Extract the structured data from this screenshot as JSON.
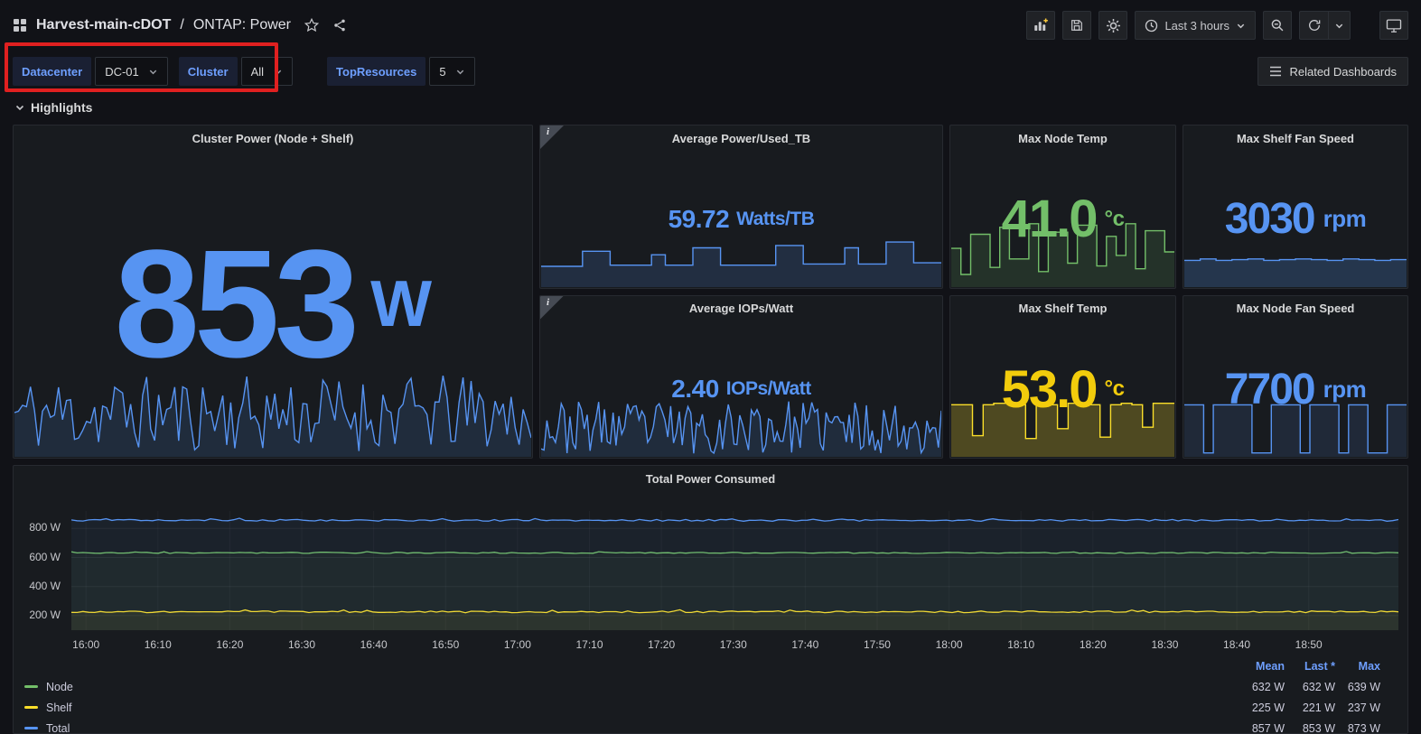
{
  "colors": {
    "blue": "#5794F2",
    "green": "#73BF69",
    "yellow": "#FADE2A",
    "yellow_text": "#F2CC0C",
    "annotation_red": "#E02020"
  },
  "topbar": {
    "breadcrumb": {
      "dashboard": "Harvest-main-cDOT",
      "separator": "/",
      "page": "ONTAP: Power"
    },
    "time_picker": {
      "label": "Last 3 hours"
    }
  },
  "variable_bar": {
    "variables": [
      {
        "label": "Datacenter",
        "value": "DC-01"
      },
      {
        "label": "Cluster",
        "value": "All"
      },
      {
        "label": "TopResources",
        "value": "5"
      }
    ],
    "related_dashboards_label": "Related Dashboards"
  },
  "rows": {
    "highlights": "Highlights"
  },
  "stats": {
    "cluster_power": {
      "title": "Cluster Power (Node + Shelf)",
      "value": "853",
      "unit": "W",
      "color": "#5794F2"
    },
    "avg_power_tb": {
      "title": "Average Power/Used_TB",
      "value": "59.72",
      "unit": "Watts/TB",
      "color": "#5794F2"
    },
    "avg_iops_watt": {
      "title": "Average IOPs/Watt",
      "value": "2.40",
      "unit": "IOPs/Watt",
      "color": "#5794F2"
    },
    "max_node_temp": {
      "title": "Max Node Temp",
      "value": "41.0",
      "unit": "°c",
      "color": "#73BF69"
    },
    "max_shelf_temp": {
      "title": "Max Shelf Temp",
      "value": "53.0",
      "unit": "°c",
      "color": "#F2CC0C"
    },
    "max_shelf_fan": {
      "title": "Max Shelf Fan Speed",
      "value": "3030",
      "unit": "rpm",
      "color": "#5794F2"
    },
    "max_node_fan": {
      "title": "Max Node Fan Speed",
      "value": "7700",
      "unit": "rpm",
      "color": "#5794F2"
    }
  },
  "total_power": {
    "title": "Total Power Consumed",
    "legend_columns": [
      "Mean",
      "Last *",
      "Max"
    ],
    "legend": [
      {
        "name": "Node",
        "color": "#73BF69",
        "mean": "632 W",
        "last": "632 W",
        "max": "639 W"
      },
      {
        "name": "Shelf",
        "color": "#FADE2A",
        "mean": "225 W",
        "last": "221 W",
        "max": "237 W"
      },
      {
        "name": "Total",
        "color": "#5794F2",
        "mean": "857 W",
        "last": "853 W",
        "max": "873 W"
      }
    ]
  },
  "chart_data": [
    {
      "id": "cluster-power-spark",
      "panel": "Cluster Power (Node + Shelf)",
      "type": "line",
      "style": "noise",
      "seed": 11,
      "points": 130,
      "range": [
        0.06,
        0.95
      ],
      "color": "#5794F2",
      "fill_opacity": 0.14,
      "current_value": 853,
      "unit": "W"
    },
    {
      "id": "avg-power-tb-spark",
      "panel": "Average Power/Used_TB",
      "type": "line",
      "style": "steps",
      "values": [
        0.36,
        0.36,
        0.36,
        0.62,
        0.62,
        0.38,
        0.38,
        0.38,
        0.56,
        0.38,
        0.38,
        0.68,
        0.68,
        0.38,
        0.38,
        0.38,
        0.38,
        0.72,
        0.72,
        0.4,
        0.4,
        0.4,
        0.68,
        0.4,
        0.4,
        0.78,
        0.78,
        0.42,
        0.42
      ],
      "color": "#5794F2",
      "fill_opacity": 0.16,
      "current_value": 59.72,
      "unit": "Watts/TB"
    },
    {
      "id": "avg-iops-watt-spark",
      "panel": "Average IOPs/Watt",
      "type": "line",
      "style": "noise",
      "seed": 23,
      "points": 140,
      "range": [
        0.05,
        0.88
      ],
      "color": "#5794F2",
      "fill_opacity": 0.14,
      "current_value": 2.4,
      "unit": "IOPs/Watt"
    },
    {
      "id": "max-node-temp-spark",
      "panel": "Max Node Temp",
      "type": "line",
      "style": "steps",
      "values": [
        0.55,
        0.18,
        0.75,
        0.75,
        0.28,
        0.85,
        0.4,
        0.4,
        0.9,
        0.22,
        0.78,
        0.78,
        0.34,
        0.88,
        0.88,
        0.3,
        0.72,
        0.45,
        0.9,
        0.26,
        0.8,
        0.8,
        0.5
      ],
      "color": "#73BF69",
      "fill_opacity": 0.14,
      "current_value": 41.0,
      "unit": "°c"
    },
    {
      "id": "max-shelf-temp-spark",
      "panel": "Max Shelf Temp",
      "type": "line",
      "style": "steps",
      "values": [
        0.74,
        0.74,
        0.3,
        0.74,
        0.76,
        0.76,
        0.74,
        0.26,
        0.74,
        0.74,
        0.4,
        0.76,
        0.74,
        0.74,
        0.28,
        0.74,
        0.76,
        0.74,
        0.42,
        0.76,
        0.76
      ],
      "color": "#FADE2A",
      "fill_opacity": 0.24,
      "current_value": 53.0,
      "unit": "°c"
    },
    {
      "id": "max-shelf-fan-spark",
      "panel": "Max Shelf Fan Speed",
      "type": "line",
      "style": "steps",
      "values": [
        0.74,
        0.78,
        0.74,
        0.76,
        0.78,
        0.74,
        0.76,
        0.78,
        0.76,
        0.74,
        0.78,
        0.76,
        0.74,
        0.76
      ],
      "color": "#5794F2",
      "fill_opacity": 0.22,
      "current_value": 3030,
      "unit": "rpm"
    },
    {
      "id": "max-node-fan-spark",
      "panel": "Max Node Fan Speed",
      "type": "line",
      "style": "steps",
      "values": [
        0.8,
        0.8,
        0.06,
        0.8,
        0.8,
        0.8,
        0.8,
        0.06,
        0.06,
        0.8,
        0.8,
        0.8,
        0.06,
        0.8,
        0.8,
        0.8,
        0.06,
        0.8,
        0.8,
        0.06,
        0.06,
        0.8,
        0.8
      ],
      "color": "#5794F2",
      "fill_opacity": 0.12,
      "current_value": 7700,
      "unit": "rpm"
    },
    {
      "id": "total-power",
      "type": "line",
      "title": "Total Power Consumed",
      "grid": true,
      "legend_position": "bottom",
      "y_unit": "W",
      "y_domain": [
        100,
        920
      ],
      "y_ticks": [
        200,
        400,
        600,
        800
      ],
      "y_tick_labels": [
        "200 W",
        "400 W",
        "600 W",
        "800 W"
      ],
      "x_tick_labels": [
        "16:00",
        "16:10",
        "16:20",
        "16:30",
        "16:40",
        "16:50",
        "17:00",
        "17:10",
        "17:20",
        "17:30",
        "17:40",
        "17:50",
        "18:00",
        "18:10",
        "18:20",
        "18:30",
        "18:40",
        "18:50"
      ],
      "series": [
        {
          "name": "Node",
          "color": "#73BF69",
          "mean": 632,
          "jitter": 4,
          "seed": 3,
          "stats": {
            "mean": "632 W",
            "last": "632 W",
            "max": "639 W"
          }
        },
        {
          "name": "Shelf",
          "color": "#FADE2A",
          "mean": 226,
          "jitter": 6,
          "seed": 9,
          "stats": {
            "mean": "225 W",
            "last": "221 W",
            "max": "237 W"
          }
        },
        {
          "name": "Total",
          "color": "#5794F2",
          "mean": 856,
          "jitter": 6,
          "seed": 5,
          "stats": {
            "mean": "857 W",
            "last": "853 W",
            "max": "873 W"
          }
        }
      ]
    }
  ]
}
